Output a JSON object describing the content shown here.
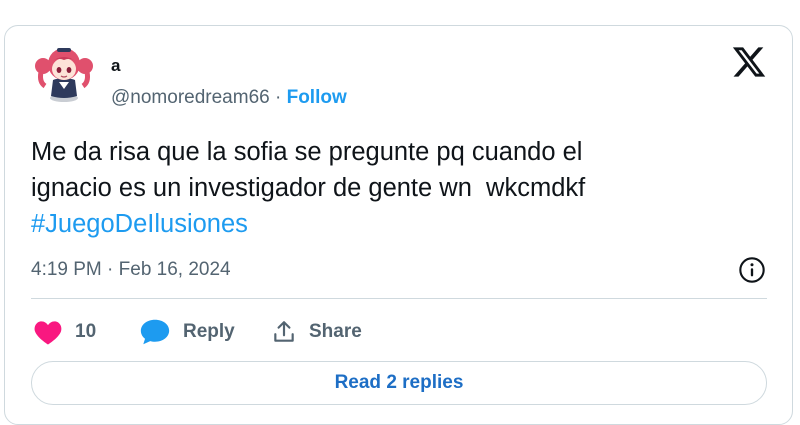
{
  "tweet": {
    "author": {
      "name": "a",
      "handle": "@nomoredream66",
      "separator": "·",
      "follow_label": "Follow",
      "avatar_icon": "anime-character-avatar"
    },
    "platform_icon": "x-logo-icon",
    "text_lines": [
      "Me da risa que la sofia se pregunte pq cuando el",
      "ignacio es un investigador de gente wn  wkcmdkf"
    ],
    "hashtag": "#JuegoDeIlusiones",
    "timestamp": "4:19 PM · Feb 16, 2024",
    "info_icon": "info-icon",
    "actions": {
      "like_count": "10",
      "reply_label": "Reply",
      "share_label": "Share"
    },
    "read_replies_label": "Read 2 replies"
  },
  "colors": {
    "accent": "#1d9bf0",
    "like": "#f91880",
    "muted": "#536471",
    "text": "#0f1419",
    "border": "#cfd9de",
    "replies_link": "#1d6ec5"
  }
}
